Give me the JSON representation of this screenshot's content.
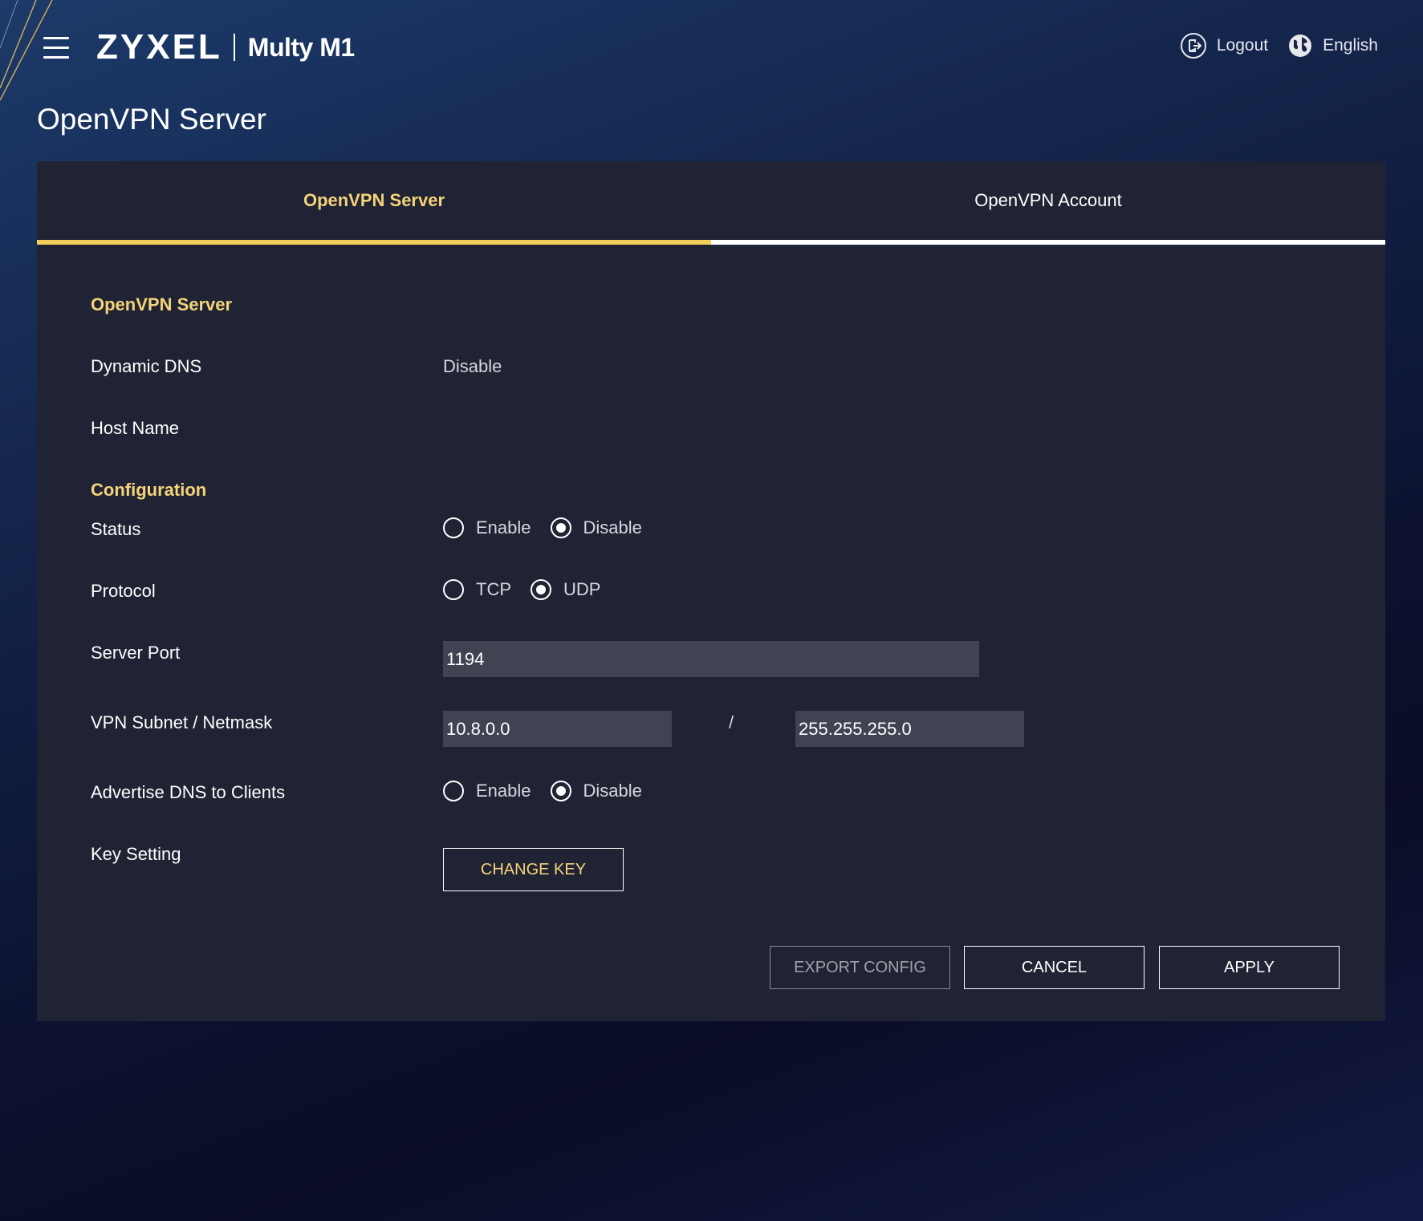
{
  "header": {
    "brand": "ZYXEL",
    "model": "Multy M1",
    "logout_label": "Logout",
    "language_label": "English"
  },
  "page": {
    "title": "OpenVPN Server"
  },
  "tabs": [
    {
      "label": "OpenVPN Server",
      "active": true
    },
    {
      "label": "OpenVPN Account",
      "active": false
    }
  ],
  "server_section": {
    "heading": "OpenVPN Server",
    "dynamic_dns_label": "Dynamic DNS",
    "dynamic_dns_value": "Disable",
    "host_name_label": "Host Name"
  },
  "config_section": {
    "heading": "Configuration",
    "status": {
      "label": "Status",
      "options": [
        "Enable",
        "Disable"
      ],
      "selected": "Disable"
    },
    "protocol": {
      "label": "Protocol",
      "options": [
        "TCP",
        "UDP"
      ],
      "selected": "UDP"
    },
    "server_port": {
      "label": "Server Port",
      "value": "1194"
    },
    "vpn_subnet": {
      "label": "VPN Subnet / Netmask",
      "subnet": "10.8.0.0",
      "separator": "/",
      "netmask": "255.255.255.0"
    },
    "advertise_dns": {
      "label": "Advertise DNS to Clients",
      "options": [
        "Enable",
        "Disable"
      ],
      "selected": "Disable"
    },
    "key_setting": {
      "label": "Key Setting",
      "button": "CHANGE KEY"
    }
  },
  "actions": {
    "export_config": "EXPORT CONFIG",
    "cancel": "CANCEL",
    "apply": "APPLY"
  },
  "colors": {
    "accent": "#f5d37a",
    "tab_indicator": "#f1cf5a",
    "panel_bg": "#1f2333",
    "input_bg": "#404352"
  }
}
